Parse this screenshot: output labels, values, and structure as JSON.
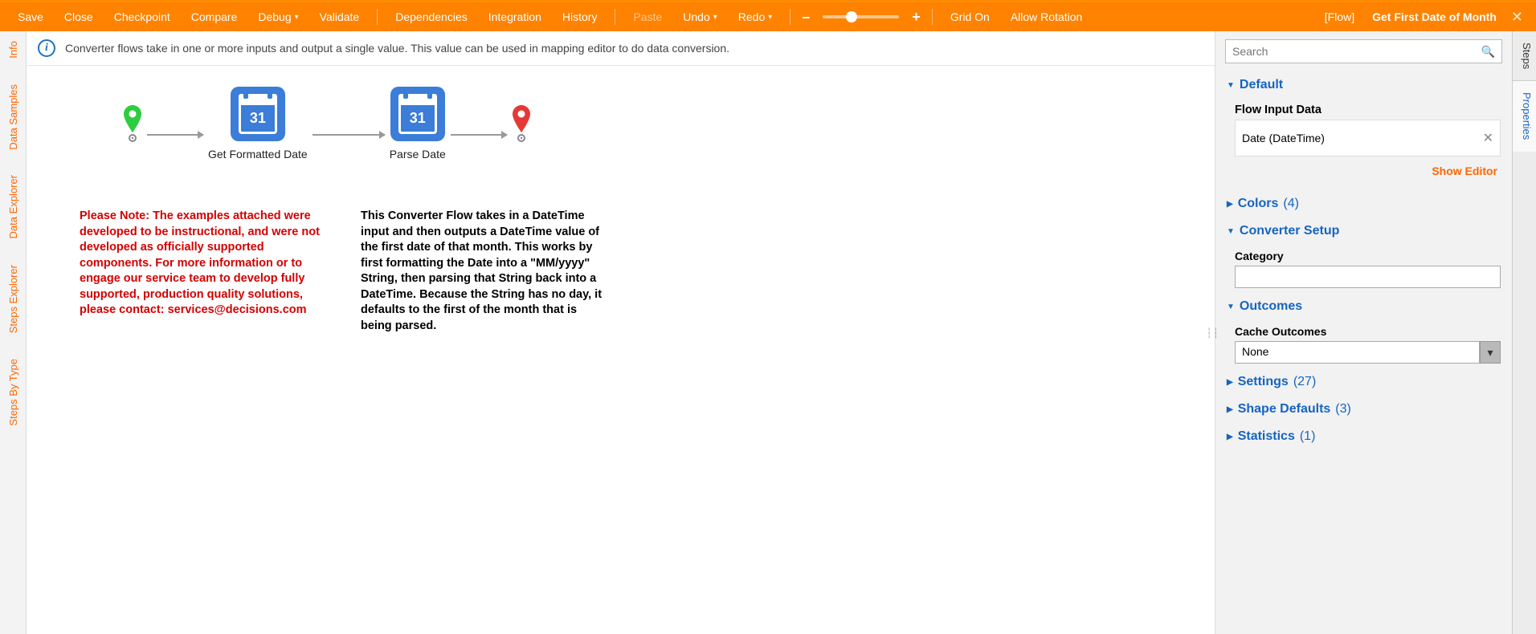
{
  "toolbar": {
    "save": "Save",
    "close": "Close",
    "checkpoint": "Checkpoint",
    "compare": "Compare",
    "debug": "Debug",
    "validate": "Validate",
    "dependencies": "Dependencies",
    "integration": "Integration",
    "history": "History",
    "paste": "Paste",
    "undo": "Undo",
    "redo": "Redo",
    "grid_on": "Grid On",
    "allow_rotation": "Allow Rotation",
    "flow_tag": "[Flow]",
    "title": "Get First Date of Month",
    "zoom_minus": "–",
    "zoom_plus": "+"
  },
  "left_tabs": [
    "Info",
    "Data Samples",
    "Data Explorer",
    "Steps Explorer",
    "Steps By Type"
  ],
  "banner": {
    "text": "Converter flows take in one or more inputs and output a single value. This value can be used in mapping editor to do data conversion."
  },
  "nodes": {
    "get_formatted_date": "Get Formatted Date",
    "parse_date": "Parse Date",
    "cal_day": "31"
  },
  "texts": {
    "note": "Please Note: The examples attached were developed to be instructional, and were not developed as officially supported components.  For more information or to engage our service team to develop fully supported, production quality solutions, please contact: services@decisions.com",
    "desc": "This Converter Flow takes in a DateTime input and then outputs a DateTime value of the first date of that month.  This works by first formatting the Date into a \"MM/yyyy\" String, then parsing that String back into a DateTime.  Because the String has no day, it defaults to the first of the month that is being parsed."
  },
  "right": {
    "search_placeholder": "Search",
    "sections": {
      "default": {
        "label": "Default"
      },
      "flow_input_data": "Flow Input Data",
      "input_item": "Date (DateTime)",
      "show_editor": "Show Editor",
      "colors": {
        "label": "Colors",
        "count": "(4)"
      },
      "converter_setup": {
        "label": "Converter Setup"
      },
      "category": "Category",
      "outcomes": {
        "label": "Outcomes"
      },
      "cache_outcomes": "Cache Outcomes",
      "cache_value": "None",
      "settings": {
        "label": "Settings",
        "count": "(27)"
      },
      "shape_defaults": {
        "label": "Shape Defaults",
        "count": "(3)"
      },
      "statistics": {
        "label": "Statistics",
        "count": "(1)"
      }
    }
  },
  "far_tabs": {
    "steps": "Steps",
    "properties": "Properties"
  }
}
